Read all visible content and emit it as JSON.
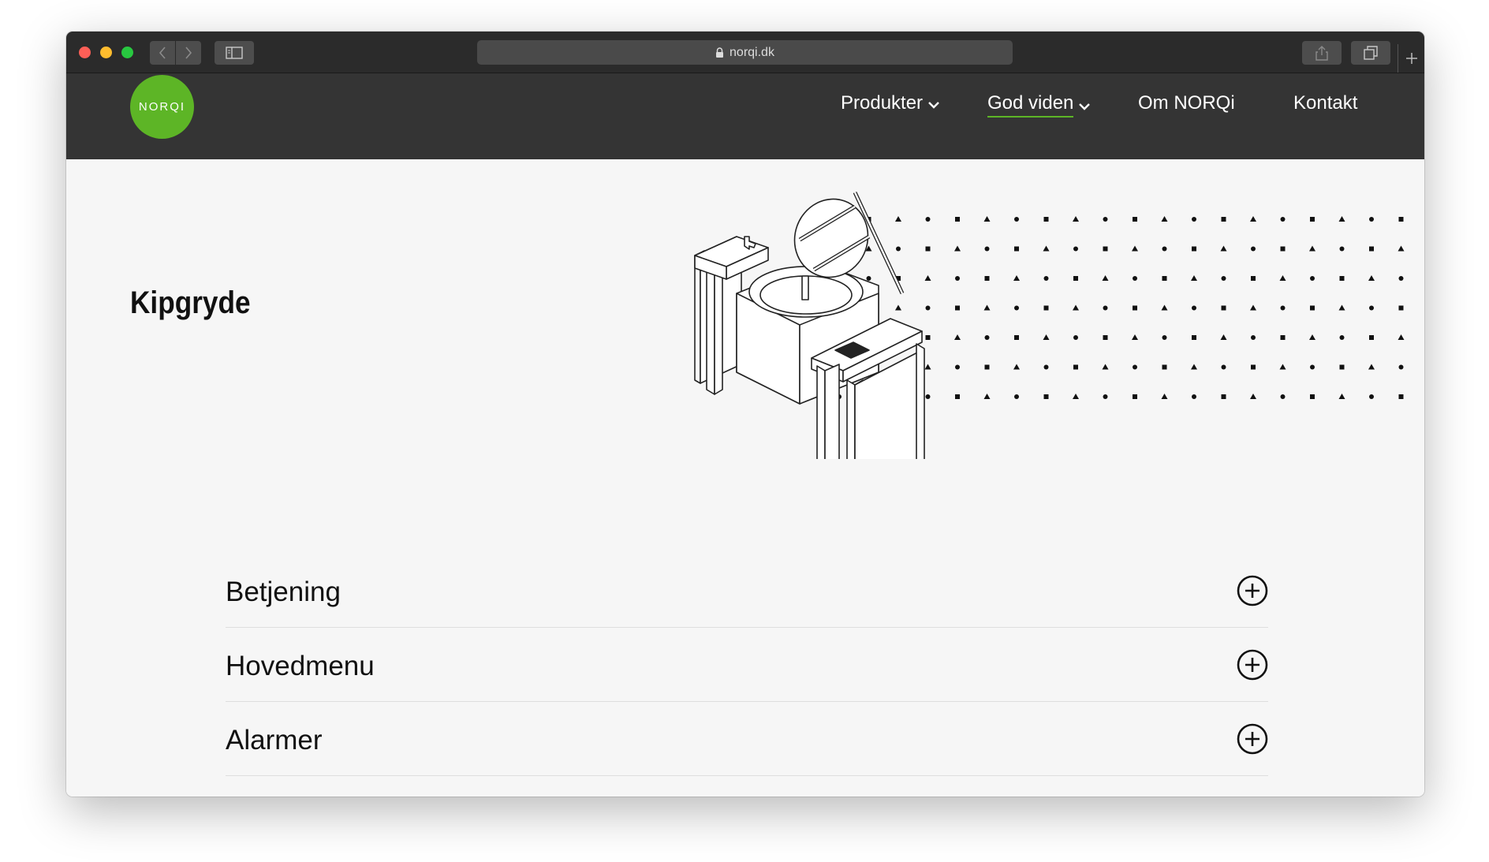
{
  "browser": {
    "url": "norqi.dk"
  },
  "header": {
    "logo_text": "NORQI",
    "nav": [
      {
        "label": "Produkter",
        "has_dropdown": true,
        "active": false
      },
      {
        "label": "God viden",
        "has_dropdown": true,
        "active": true
      },
      {
        "label": "Om NORQi",
        "has_dropdown": false,
        "active": false
      },
      {
        "label": "Kontakt",
        "has_dropdown": false,
        "active": false
      }
    ]
  },
  "main": {
    "title": "Kipgryde",
    "accordion": [
      {
        "label": "Betjening",
        "icon": "plus-circle-icon"
      },
      {
        "label": "Hovedmenu",
        "icon": "plus-circle-icon"
      },
      {
        "label": "Alarmer",
        "icon": "plus-circle-icon"
      }
    ]
  },
  "colors": {
    "brand_green": "#5db526",
    "header_bg": "#343434",
    "page_bg": "#f6f6f6"
  }
}
